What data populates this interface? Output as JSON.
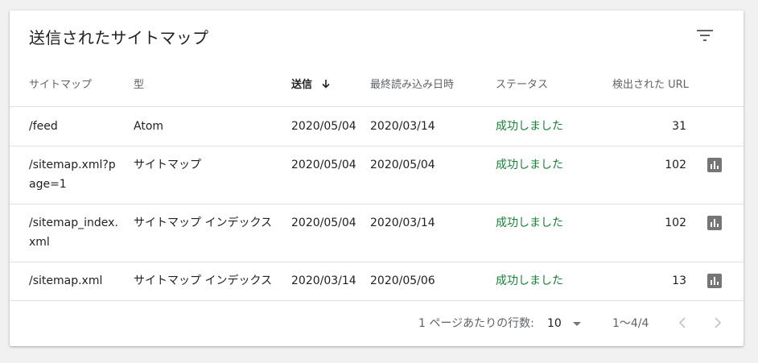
{
  "card": {
    "title": "送信されたサイトマップ"
  },
  "table": {
    "headers": {
      "sitemap": "サイトマップ",
      "type": "型",
      "submitted": "送信",
      "last_read": "最終読み込み日時",
      "status": "ステータス",
      "discovered": "検出された URL"
    },
    "sort_column": "submitted",
    "sort_direction": "descending",
    "rows": [
      {
        "sitemap": "/feed",
        "type": "Atom",
        "submitted": "2020/05/04",
        "last_read": "2020/03/14",
        "status": "成功しました",
        "discovered": "31",
        "has_chart": false
      },
      {
        "sitemap": "/sitemap.xml?page=1",
        "type": "サイトマップ",
        "submitted": "2020/05/04",
        "last_read": "2020/05/04",
        "status": "成功しました",
        "discovered": "102",
        "has_chart": true
      },
      {
        "sitemap": "/sitemap_index.xml",
        "type": "サイトマップ インデックス",
        "submitted": "2020/05/04",
        "last_read": "2020/03/14",
        "status": "成功しました",
        "discovered": "102",
        "has_chart": true
      },
      {
        "sitemap": "/sitemap.xml",
        "type": "サイトマップ インデックス",
        "submitted": "2020/03/14",
        "last_read": "2020/05/06",
        "status": "成功しました",
        "discovered": "13",
        "has_chart": true
      }
    ]
  },
  "footer": {
    "rows_per_page_label": "1 ページあたりの行数:",
    "rows_per_page_value": "10",
    "range": "1〜4/4"
  },
  "icons": {
    "filter": "filter-icon",
    "sort": "arrow-down-icon",
    "chart": "bar-chart-icon",
    "dropdown": "dropdown-caret-icon",
    "prev": "chevron-left-icon",
    "next": "chevron-right-icon"
  },
  "colors": {
    "status_success": "#188038",
    "chart_icon": "#757575",
    "divider": "#e0e0e0"
  }
}
